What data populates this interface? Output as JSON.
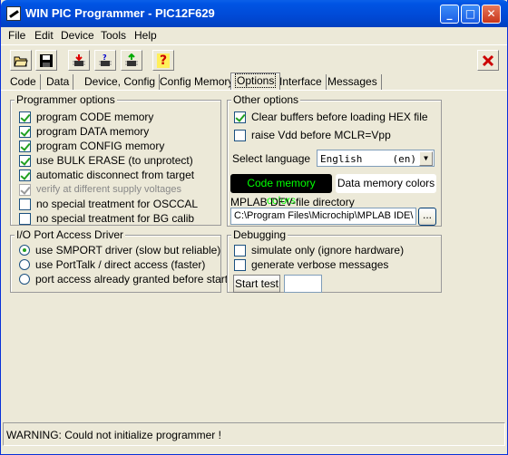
{
  "window": {
    "title": "WIN PIC Programmer  -  PIC12F629",
    "minimize": "_",
    "maximize": "□",
    "close": "✕"
  },
  "menu": [
    "File",
    "Edit",
    "Device",
    "Tools",
    "Help"
  ],
  "toolbar": {
    "icons": [
      "open-icon",
      "save-icon",
      "program-icon",
      "verify-icon",
      "read-icon",
      "help-icon",
      "stop-icon"
    ],
    "help_glyph": "?"
  },
  "tabs": [
    "Code",
    "Data",
    "Device, Config",
    "Config Memory",
    "Options",
    "Interface",
    "Messages"
  ],
  "active_tab": "Options",
  "programmer_options": {
    "title": "Programmer options",
    "items": [
      {
        "label": "program CODE memory",
        "checked": true
      },
      {
        "label": "program DATA memory",
        "checked": true
      },
      {
        "label": "program CONFIG memory",
        "checked": true
      },
      {
        "label": "use BULK ERASE  (to unprotect)",
        "checked": true
      },
      {
        "label": "automatic disconnect from target",
        "checked": true
      },
      {
        "label": "verify at different supply voltages",
        "checked": true,
        "disabled": true
      },
      {
        "label": "no special treatment for OSCCAL",
        "checked": false
      },
      {
        "label": "no special treatment for BG calib",
        "checked": false
      }
    ]
  },
  "port_access": {
    "title": "I/O Port Access Driver",
    "items": [
      {
        "label": "use SMPORT driver (slow but reliable)",
        "selected": true
      },
      {
        "label": "use PortTalk / direct access (faster)",
        "selected": false
      },
      {
        "label": "port access already granted before start",
        "selected": false
      }
    ]
  },
  "other_options": {
    "title": "Other options",
    "clear_buffers": {
      "label": "Clear buffers before loading HEX file",
      "checked": true
    },
    "raise_vdd": {
      "label": "raise Vdd before  MCLR=Vpp",
      "checked": false
    },
    "language_label": "Select language",
    "language_value": "English",
    "language_code": "(en)",
    "code_colors_button": "Code memory colors",
    "data_colors_button": "Data memory colors",
    "mplab_label": "MPLAB DEV-file directory",
    "mplab_path": "C:\\Program Files\\Microchip\\MPLAB IDE\\",
    "browse_button": "..."
  },
  "debugging": {
    "title": "Debugging",
    "simulate": {
      "label": "simulate only (ignore hardware)",
      "checked": false
    },
    "verbose": {
      "label": "generate verbose messages",
      "checked": false
    },
    "start_test_button": "Start test",
    "test_value": ""
  },
  "status": "WARNING: Could not initialize programmer !",
  "colors": {
    "title_bar": "#0054e3",
    "code_colors_bg": "#000000",
    "code_colors_fg": "#00ff00",
    "close_red": "#cc0000"
  }
}
